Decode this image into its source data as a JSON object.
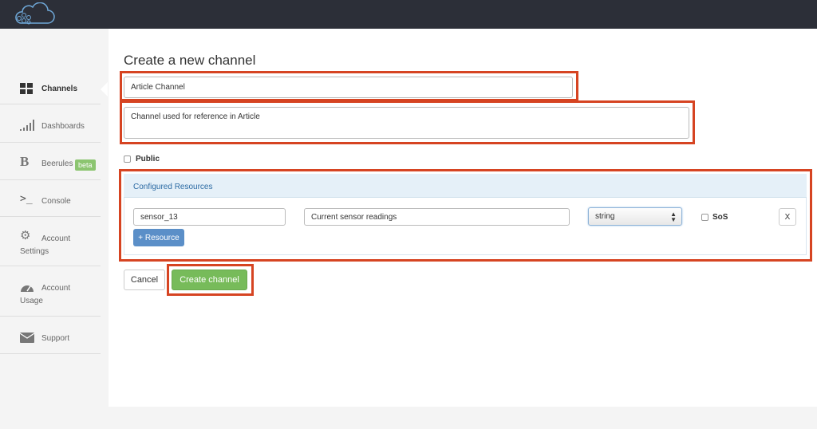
{
  "page": {
    "title": "Create a new channel"
  },
  "sidebar": {
    "items": [
      {
        "label": "Channels",
        "icon": "grid-icon"
      },
      {
        "label": "Dashboards",
        "icon": "signal-bars-icon"
      },
      {
        "label": "Beerules",
        "icon": "beerules-b-icon",
        "badge": "beta"
      },
      {
        "label": "Console",
        "icon": "terminal-prompt-icon"
      },
      {
        "label": "Account",
        "label2": "Settings",
        "icon": "gears-icon"
      },
      {
        "label": "Account",
        "label2": "Usage",
        "icon": "gauge-icon"
      },
      {
        "label": "Support",
        "icon": "envelope-icon"
      }
    ]
  },
  "form": {
    "name_value": "Article Channel",
    "description_value": "Channel used for reference in Article",
    "public_label": "Public"
  },
  "resources": {
    "header": "Configured Resources",
    "rows": [
      {
        "name": "sensor_13",
        "description": "Current sensor readings",
        "type": "string",
        "sos_label": "SoS",
        "remove_label": "X"
      }
    ],
    "add_label": "+ Resource"
  },
  "actions": {
    "cancel_label": "Cancel",
    "create_label": "Create channel"
  },
  "colors": {
    "topbar": "#2c2f38",
    "highlight": "#d64422",
    "primary": "#5b8fc8",
    "success": "#77bb5a",
    "beta": "#8cc570"
  }
}
